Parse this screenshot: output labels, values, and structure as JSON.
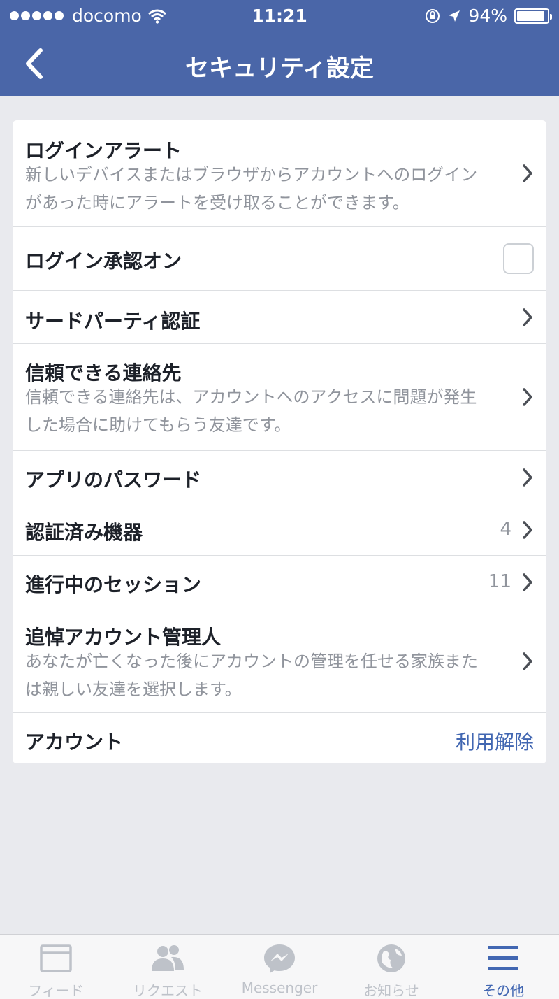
{
  "statusbar": {
    "carrier": "docomo",
    "time": "11:21",
    "battery": "94%",
    "battery_level": 0.94
  },
  "nav": {
    "title": "セキュリティ設定"
  },
  "rows": [
    {
      "title": "ログインアラート",
      "desc_line1": "新しいデバイスまたはブラウザからアカウントへのログイン",
      "desc_line2": "があった時にアラートを受け取ることができます。"
    },
    {
      "title": "ログイン承認オン",
      "checked": false
    },
    {
      "title": "サードパーティ認証"
    },
    {
      "title": "信頼できる連絡先",
      "desc_line1": "信頼できる連絡先は、アカウントへのアクセスに問題が発生",
      "desc_line2": "した場合に助けてもらう友達です。"
    },
    {
      "title": "アプリのパスワード"
    },
    {
      "title": "認証済み機器",
      "count": "4"
    },
    {
      "title": "進行中のセッション",
      "count": "11"
    },
    {
      "title": "追悼アカウント管理人",
      "desc_line1": "あなたが亡くなった後にアカウントの管理を任せる家族また",
      "desc_line2": "は親しい友達を選択します。"
    },
    {
      "title": "アカウント",
      "action": "利用解除"
    }
  ],
  "tabs": [
    {
      "label": "フィード",
      "icon": "feed-icon"
    },
    {
      "label": "リクエスト",
      "icon": "friend-requests-icon"
    },
    {
      "label": "Messenger",
      "icon": "messenger-icon"
    },
    {
      "label": "お知らせ",
      "icon": "notifications-globe-icon"
    },
    {
      "label": "その他",
      "icon": "menu-icon",
      "active": true
    }
  ],
  "colors": {
    "header_blue": "#4a66a8",
    "link_blue": "#4267b2",
    "background": "#e9eaee",
    "muted_text": "#90949c"
  }
}
